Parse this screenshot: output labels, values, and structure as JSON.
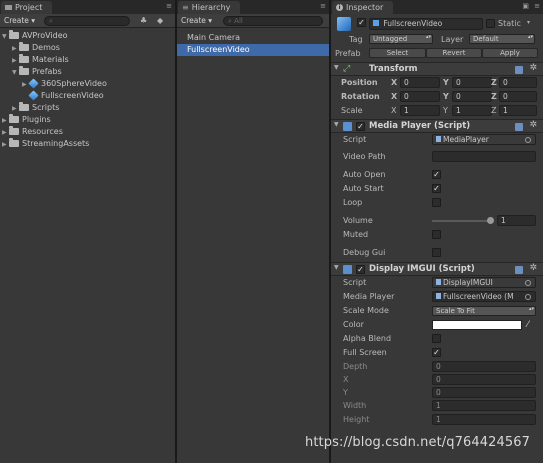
{
  "project": {
    "tab_label": "Project",
    "create_label": "Create ▾",
    "items": [
      {
        "label": "AVProVideo",
        "kind": "folder",
        "expanded": true
      },
      {
        "label": "Demos",
        "kind": "folder",
        "expanded": false
      },
      {
        "label": "Materials",
        "kind": "folder",
        "expanded": false
      },
      {
        "label": "Prefabs",
        "kind": "folder",
        "expanded": true
      },
      {
        "label": "360SphereVideo",
        "kind": "prefab",
        "expanded": false
      },
      {
        "label": "FullscreenVideo",
        "kind": "prefab",
        "expanded": false
      },
      {
        "label": "Scripts",
        "kind": "folder",
        "expanded": false
      },
      {
        "label": "Plugins",
        "kind": "folder",
        "expanded": false
      },
      {
        "label": "Resources",
        "kind": "folder",
        "expanded": false
      },
      {
        "label": "StreamingAssets",
        "kind": "folder",
        "expanded": false
      }
    ]
  },
  "hierarchy": {
    "tab_label": "Hierarchy",
    "create_label": "Create ▾",
    "search_placeholder": "All",
    "items": [
      {
        "label": "Main Camera"
      },
      {
        "label": "FullscreenVideo",
        "selected": true
      }
    ]
  },
  "inspector": {
    "tab_label": "Inspector",
    "object_name": "FullscreenVideo",
    "static_label": "Static",
    "tag_label": "Tag",
    "tag_value": "Untagged",
    "layer_label": "Layer",
    "layer_value": "Default",
    "prefab_label": "Prefab",
    "prefab_buttons": {
      "select": "Select",
      "revert": "Revert",
      "apply": "Apply"
    },
    "transform": {
      "title": "Transform",
      "position_label": "Position",
      "rotation_label": "Rotation",
      "scale_label": "Scale",
      "axis_x": "X",
      "axis_y": "Y",
      "axis_z": "Z",
      "position": [
        "0",
        "0",
        "0"
      ],
      "rotation": [
        "0",
        "0",
        "0"
      ],
      "scale": [
        "1",
        "1",
        "1"
      ]
    },
    "media_player": {
      "title": "Media Player (Script)",
      "script_label": "Script",
      "script_value": "MediaPlayer",
      "video_path_label": "Video Path",
      "video_path_value": "",
      "auto_open_label": "Auto Open",
      "auto_open": true,
      "auto_start_label": "Auto Start",
      "auto_start": true,
      "loop_label": "Loop",
      "loop": false,
      "volume_label": "Volume",
      "volume": "1",
      "muted_label": "Muted",
      "muted": false,
      "debug_gui_label": "Debug Gui",
      "debug_gui": false
    },
    "display_imgui": {
      "title": "Display IMGUI (Script)",
      "script_label": "Script",
      "script_value": "DisplayIMGUI",
      "media_player_label": "Media Player",
      "media_player_value": "FullscreenVideo (M",
      "scale_mode_label": "Scale Mode",
      "scale_mode_value": "Scale To Fit",
      "color_label": "Color",
      "color_value": "#ffffff",
      "alpha_blend_label": "Alpha Blend",
      "alpha_blend": false,
      "full_screen_label": "Full Screen",
      "full_screen": true,
      "depth_label": "Depth",
      "depth": "0",
      "x_label": "X",
      "x": "0",
      "y_label": "Y",
      "y": "0",
      "width_label": "Width",
      "width": "1",
      "height_label": "Height",
      "height": "1"
    }
  },
  "watermark": "https://blog.csdn.net/q764424567",
  "colors": {
    "selection": "#3e6aaa",
    "panel": "#383838",
    "background": "#191919"
  }
}
